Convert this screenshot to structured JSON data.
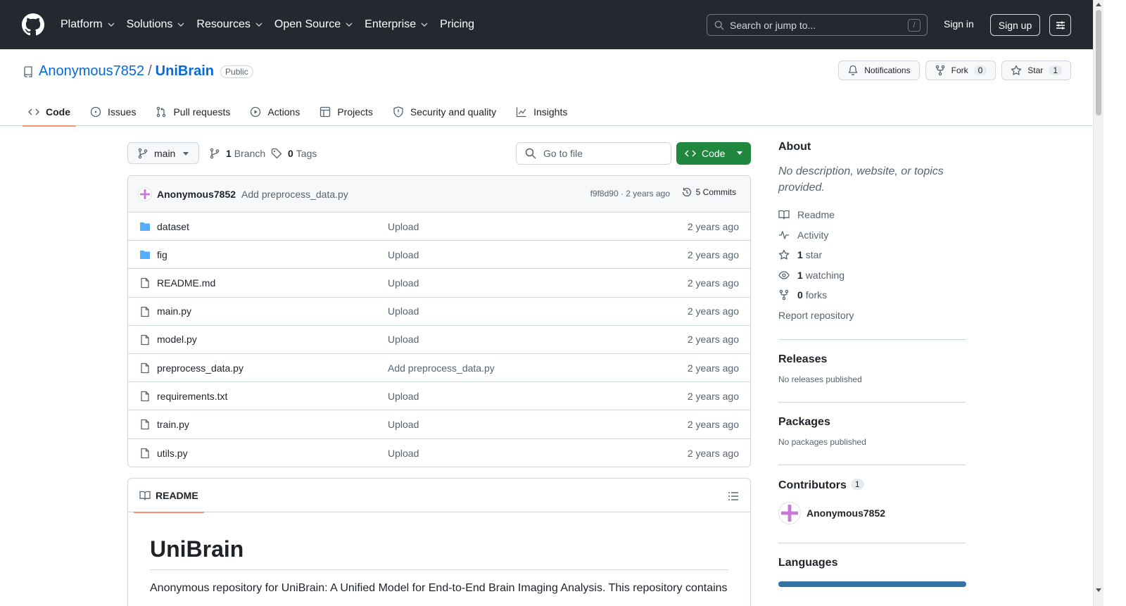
{
  "header": {
    "nav": [
      {
        "label": "Platform",
        "dropdown": true
      },
      {
        "label": "Solutions",
        "dropdown": true
      },
      {
        "label": "Resources",
        "dropdown": true
      },
      {
        "label": "Open Source",
        "dropdown": true
      },
      {
        "label": "Enterprise",
        "dropdown": true
      },
      {
        "label": "Pricing",
        "dropdown": false
      }
    ],
    "search_placeholder": "Search or jump to...",
    "search_shortcut": "/",
    "signin": "Sign in",
    "signup": "Sign up"
  },
  "repo": {
    "owner": "Anonymous7852",
    "separator": "/",
    "name": "UniBrain",
    "visibility": "Public",
    "actions": {
      "notifications": "Notifications",
      "fork_label": "Fork",
      "fork_count": "0",
      "star_label": "Star",
      "star_count": "1"
    },
    "tabs": [
      {
        "label": "Code",
        "icon": "code-icon",
        "active": true
      },
      {
        "label": "Issues",
        "icon": "issue-icon",
        "active": false
      },
      {
        "label": "Pull requests",
        "icon": "pull-request-icon",
        "active": false
      },
      {
        "label": "Actions",
        "icon": "play-icon",
        "active": false
      },
      {
        "label": "Projects",
        "icon": "table-icon",
        "active": false
      },
      {
        "label": "Security and quality",
        "icon": "shield-icon",
        "active": false
      },
      {
        "label": "Insights",
        "icon": "graph-icon",
        "active": false
      }
    ]
  },
  "toolbar": {
    "branch": "main",
    "branches_count": "1",
    "branches_label": "Branch",
    "tags_count": "0",
    "tags_label": "Tags",
    "gofile_placeholder": "Go to file",
    "code_button": "Code"
  },
  "commit": {
    "author": "Anonymous7852",
    "message": "Add preprocess_data.py",
    "meta": "f9f8d90 · 2 years ago",
    "count": "5 Commits"
  },
  "files": [
    {
      "name": "dataset",
      "type": "folder",
      "message": "Upload",
      "date": "2 years ago"
    },
    {
      "name": "fig",
      "type": "folder",
      "message": "Upload",
      "date": "2 years ago"
    },
    {
      "name": "README.md",
      "type": "file",
      "message": "Upload",
      "date": "2 years ago"
    },
    {
      "name": "main.py",
      "type": "file",
      "message": "Upload",
      "date": "2 years ago"
    },
    {
      "name": "model.py",
      "type": "file",
      "message": "Upload",
      "date": "2 years ago"
    },
    {
      "name": "preprocess_data.py",
      "type": "file",
      "message": "Add preprocess_data.py",
      "date": "2 years ago"
    },
    {
      "name": "requirements.txt",
      "type": "file",
      "message": "Upload",
      "date": "2 years ago"
    },
    {
      "name": "train.py",
      "type": "file",
      "message": "Upload",
      "date": "2 years ago"
    },
    {
      "name": "utils.py",
      "type": "file",
      "message": "Upload",
      "date": "2 years ago"
    }
  ],
  "readme": {
    "tab": "README",
    "title": "UniBrain",
    "intro": "Anonymous repository for UniBrain: A Unified Model for End-to-End Brain Imaging Analysis. This repository contains"
  },
  "sidebar": {
    "about_title": "About",
    "about_desc": "No description, website, or topics provided.",
    "readme": "Readme",
    "activity": "Activity",
    "stars_count": "1",
    "stars_label": "star",
    "watching_count": "1",
    "watching_label": "watching",
    "forks_count": "0",
    "forks_label": "forks",
    "report": "Report repository",
    "releases_title": "Releases",
    "releases_text": "No releases published",
    "packages_title": "Packages",
    "packages_text": "No packages published",
    "contributors_title": "Contributors",
    "contributors_count": "1",
    "contributor_name": "Anonymous7852",
    "languages_title": "Languages"
  },
  "colors": {
    "header_bg": "#24292f",
    "link": "#0969da",
    "code_button": "#1f883d",
    "active_tab": "#fd8c73",
    "folder_icon": "#54aeff",
    "language_python": "#3572A5"
  }
}
